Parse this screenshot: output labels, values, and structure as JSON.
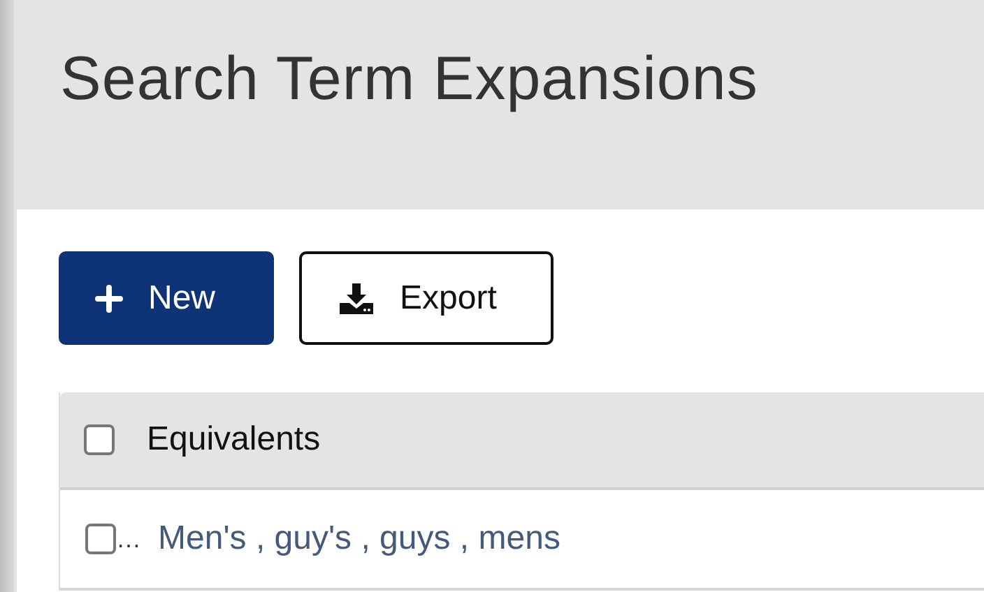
{
  "page": {
    "title": "Search Term Expansions"
  },
  "toolbar": [
    {
      "kind": "primary",
      "label": "New"
    },
    {
      "kind": "export",
      "label": "Export"
    }
  ],
  "table": {
    "header": {
      "checked": false,
      "label": "Equivalents"
    },
    "rows": [
      {
        "checked": false,
        "overflow": "…",
        "equivalents": "Men's , guy's , guys , mens"
      }
    ]
  }
}
